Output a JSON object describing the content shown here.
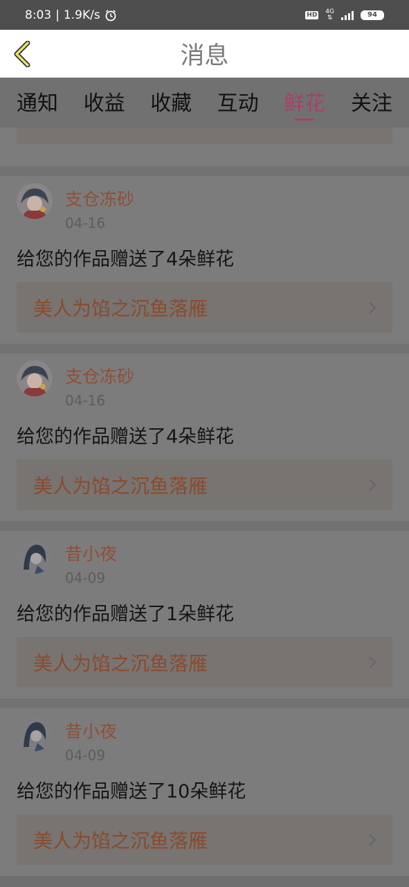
{
  "status_bar": {
    "time": "8:03",
    "speed": "1.9K/s",
    "hd": "HD",
    "network": "4G",
    "battery": "94"
  },
  "header": {
    "title": "消息"
  },
  "tabs": [
    {
      "label": "通知",
      "active": false
    },
    {
      "label": "收益",
      "active": false
    },
    {
      "label": "收藏",
      "active": false
    },
    {
      "label": "互动",
      "active": false
    },
    {
      "label": "鲜花",
      "active": true
    },
    {
      "label": "关注",
      "active": false
    }
  ],
  "messages": [
    {
      "user": "支仓冻砂",
      "date": "04-16",
      "text": "给您的作品赠送了4朵鲜花",
      "work": "美人为馅之沉鱼落雁"
    },
    {
      "user": "支仓冻砂",
      "date": "04-16",
      "text": "给您的作品赠送了4朵鲜花",
      "work": "美人为馅之沉鱼落雁"
    },
    {
      "user": "昔小夜",
      "date": "04-09",
      "text": "给您的作品赠送了1朵鲜花",
      "work": "美人为馅之沉鱼落雁"
    },
    {
      "user": "昔小夜",
      "date": "04-09",
      "text": "给您的作品赠送了10朵鲜花",
      "work": "美人为馅之沉鱼落雁"
    }
  ],
  "colors": {
    "accent": "#a8406a",
    "username": "#914e36",
    "overlay": "#6f6f6f"
  }
}
